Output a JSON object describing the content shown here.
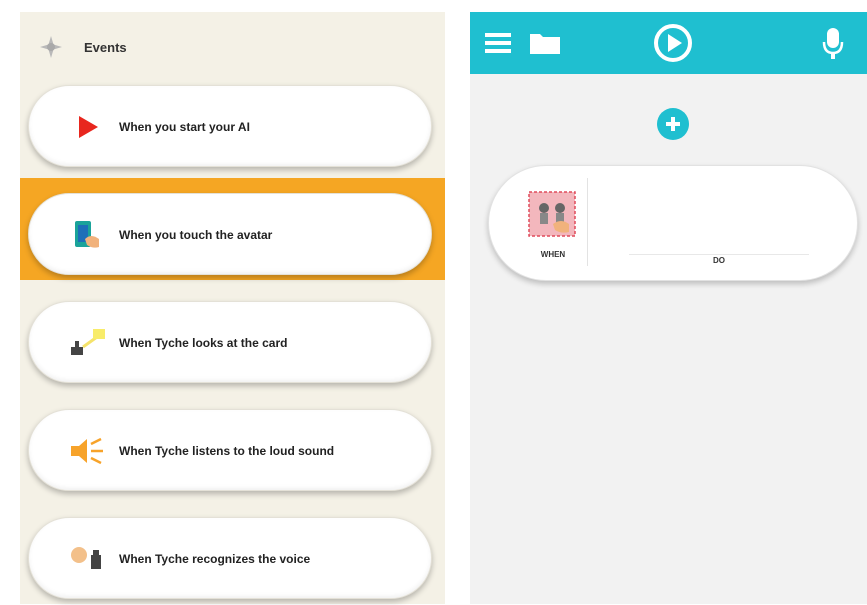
{
  "events_panel": {
    "title": "Events",
    "icons": {
      "header": "gear-star-icon"
    },
    "items": [
      {
        "label": "When you start your AI",
        "icon": "play-triangle-icon",
        "selected": false
      },
      {
        "label": "When you touch the avatar",
        "icon": "touch-avatar-icon",
        "selected": true
      },
      {
        "label": "When Tyche looks at the card",
        "icon": "look-card-icon",
        "selected": false
      },
      {
        "label": "When Tyche listens to the loud sound",
        "icon": "loud-sound-icon",
        "selected": false
      },
      {
        "label": "When Tyche recognizes the voice",
        "icon": "recognize-voice-icon",
        "selected": false
      }
    ]
  },
  "editor": {
    "toolbar": {
      "icons": [
        "menu-icon",
        "folder-icon",
        "play-circle-icon",
        "microphone-icon"
      ]
    },
    "rule": {
      "when_label": "WHEN",
      "do_label": "DO"
    }
  },
  "colors": {
    "accent": "#1fbfd0",
    "selected": "#f5a623",
    "panel_bg": "#f4f1e6"
  }
}
